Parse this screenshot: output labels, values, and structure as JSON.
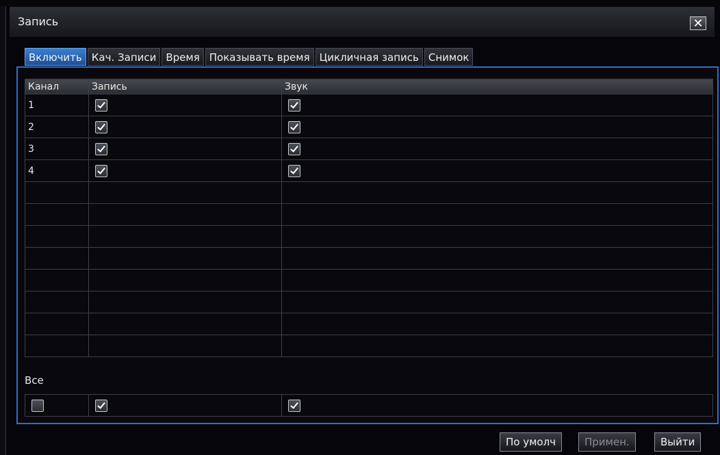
{
  "window": {
    "title": "Запись",
    "close_glyph": "✕"
  },
  "tabs": [
    {
      "label": "Включить",
      "active": true
    },
    {
      "label": "Кач. Записи",
      "active": false
    },
    {
      "label": "Время",
      "active": false
    },
    {
      "label": "Показывать время",
      "active": false
    },
    {
      "label": "Цикличная запись",
      "active": false
    },
    {
      "label": "Снимок",
      "active": false
    }
  ],
  "table": {
    "headers": [
      "Канал",
      "Запись",
      "Звук"
    ],
    "rows": [
      {
        "channel": "1",
        "record": true,
        "audio": true
      },
      {
        "channel": "2",
        "record": true,
        "audio": true
      },
      {
        "channel": "3",
        "record": true,
        "audio": true
      },
      {
        "channel": "4",
        "record": true,
        "audio": true
      }
    ],
    "empty_rows": 8
  },
  "all": {
    "label": "Все",
    "channel": false,
    "record": true,
    "audio": true
  },
  "buttons": {
    "default": "По умолч",
    "apply": "Примен.",
    "exit": "Выйти"
  },
  "colors": {
    "accent": "#2f6fc8",
    "active_tab": "#3a7fd0"
  }
}
